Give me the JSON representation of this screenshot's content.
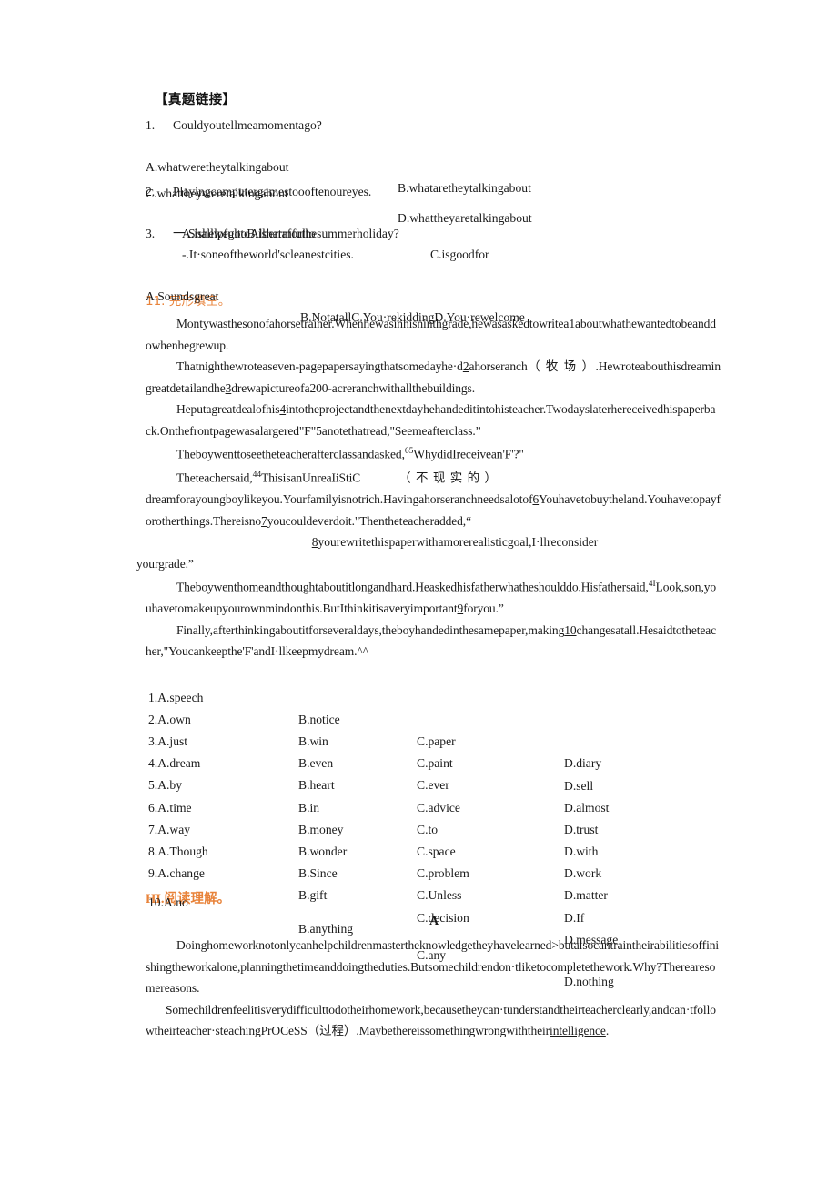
{
  "document": {
    "section_zhenti": {
      "heading": "【真题链接】",
      "questions": [
        {
          "number": "1.",
          "stem": "Couldyoutellmeamomentago?",
          "options_line1": {
            "a": "A.whatweretheytalkingabout",
            "b": "B.whataretheytalkingabout"
          },
          "options_line2": {
            "c": "C.whattheyweretalkingabout",
            "d": "D.whattheyaretalkingabout"
          }
        },
        {
          "number": "2.",
          "stem": "Playingcomputergamestoooftenoureyes.",
          "options_line1": {
            "ab": "A.ishelpfultoB.isharmfulto",
            "c": "C.isgoodfor"
          }
        },
        {
          "number": "3.",
          "stem": "一 ShallwegotoAlbertaforthesummerholiday?",
          "reply": "-.It·soneoftheworld'scleanestcities.",
          "options_line1": {
            "a": "A.Soundsgreat",
            "bcd": "B.NotatallC.You·rekiddingD.You·rewelcome"
          }
        }
      ]
    },
    "section_cloze": {
      "heading_number": "11.",
      "heading_text": "完形填空。",
      "paragraphs": [
        {
          "id": "p1",
          "lines": [
            "Montywasthesonofahorsetrainer.Whenhewasinhisninthgrade,hewasaskedtowritea",
            "1",
            "aboutwhathewantedtobeanddowhenhegrewup."
          ]
        },
        {
          "id": "p2",
          "prefix": "Thatnighthewroteaseven-pagepapersayingthatsomedayhe·d",
          "blank": "2",
          "mid": "ahorseranch",
          "paren": "（ 牧 场 ）",
          "suffix": ".Hewroteabouthisdreamingreatdetailandhe",
          "blank2": "3",
          "tail": "drewapictureofa200-acreranchwithallthebuildings."
        },
        {
          "id": "p3",
          "prefix": "Heputagreatdealofhis",
          "blank": "4",
          "mid": "intotheprojectandthenextdayhehandeditintohisteacher.Twodayslaterhereceivedhispaperback.Onthefrontpagewasalargered\"F\"",
          "blank2": "5",
          "tail": "anotethatread,\"Seemeafterclass.”"
        },
        {
          "id": "p4",
          "text": "Theboywenttoseetheteacherafterclassandasked,",
          "sup": "65",
          "tail": "WhydidIreceivean'F'?\""
        },
        {
          "id": "p5",
          "prefix": "Theteachersaid,",
          "sup": "44",
          "mid": "ThisisanUnreaIiStiC",
          "paren": "（ 不 现 实 的 ）",
          "cont1": "dreamforayoungboylikeyou.Yourfamilyisnotrich.Havingahorseranchneedsalotof",
          "blank": "6",
          "cont2": "Youhavetobuytheland.Youhavetopayforotherthings.Thereisno",
          "blank2": "7",
          "cont3": "youcouldeverdoit.\"Thentheteacheradded,“",
          "centered_blank": "8",
          "centered_text": "yourewritethispaperwithamorerealisticgoal,I·llreconsider",
          "cont4": "yourgrade.”"
        },
        {
          "id": "p6",
          "prefix": "Theboywenthomeandthoughtaboutitlongandhard.Heaskedhisfatherwhatheshoulddo.Hisfathersaid,",
          "sup": "4I",
          "mid": "Look,son,youhavetomakeupyourownmindonthis.ButIthinkitisaveryimportant",
          "blank": "9",
          "tail": "foryou.”"
        },
        {
          "id": "p7",
          "prefix": "Finally,afterthinkingaboutitforseveraldays,theboyhandedinthesamepaper,making",
          "blank": "10",
          "tail": "changesatall.Hesaidtotheteacher,\"Youcankeepthe'F'andI·llkeepmydream.^^"
        }
      ],
      "options": [
        {
          "n": "1.",
          "a": "A.speech",
          "b": "B.notice",
          "c": "C.paper",
          "d": "D.diary"
        },
        {
          "n": "2.",
          "a": "A.own",
          "b": "B.win",
          "c": "C.paint",
          "d": "D.sell"
        },
        {
          "n": "3.",
          "a": "A.just",
          "b": "B.even",
          "c": "C.ever",
          "d": "D.almost"
        },
        {
          "n": "4.",
          "a": "A.dream",
          "b": "B.heart",
          "c": "C.advice",
          "d": "D.trust"
        },
        {
          "n": "5.",
          "a": "A.by",
          "b": "B.in",
          "c": "C.to",
          "d": "D.with"
        },
        {
          "n": "6.",
          "a": "A.time",
          "b": "B.money",
          "c": "C.space",
          "d": "D.work"
        },
        {
          "n": "7.",
          "a": "A.way",
          "b": "B.wonder",
          "c": "C.problem",
          "d": "D.matter"
        },
        {
          "n": "8.",
          "a": "A.Though",
          "b": "B.Since",
          "c": "C.Unless",
          "d": "D.If"
        },
        {
          "n": "9.",
          "a": "A.change",
          "b": "B.gift",
          "c": "C.decision",
          "d": "D.message"
        },
        {
          "n": "10.",
          "a": "A.no",
          "b": "B.anything",
          "c": "C.any",
          "d": "D.nothing"
        }
      ]
    },
    "section_reading": {
      "heading_number": "HI.",
      "heading_text": "阅读理解。",
      "passage_label": "A",
      "paragraph_1": "Doinghomeworknotonlycanhelpchildrenmastertheknowledgetheyhavelearned>butalsocantraintheirabilitiesoffinishingtheworkalone,planningthetimeanddoingtheduties.Butsomechildrendon·tliketocompletethework.Why?Therearesomereasons.",
      "paragraph_2_part1": "Somechildrenfeelitisverydifficulttodotheirhomework,becausetheycan·tunderstandtheirteacherclearly,andcan·tfollowtheirteacher·steachingPrOCeSS",
      "paragraph_2_paren": "（过程）",
      "paragraph_2_part2": ".Maybethereissomethingwrongwiththeir",
      "paragraph_2_underlined": "intelligence",
      "paragraph_2_end": "."
    }
  },
  "colors": {
    "heading_orange": "#E8833A",
    "text_black": "#1a1a1a",
    "page_background": "#ffffff"
  }
}
